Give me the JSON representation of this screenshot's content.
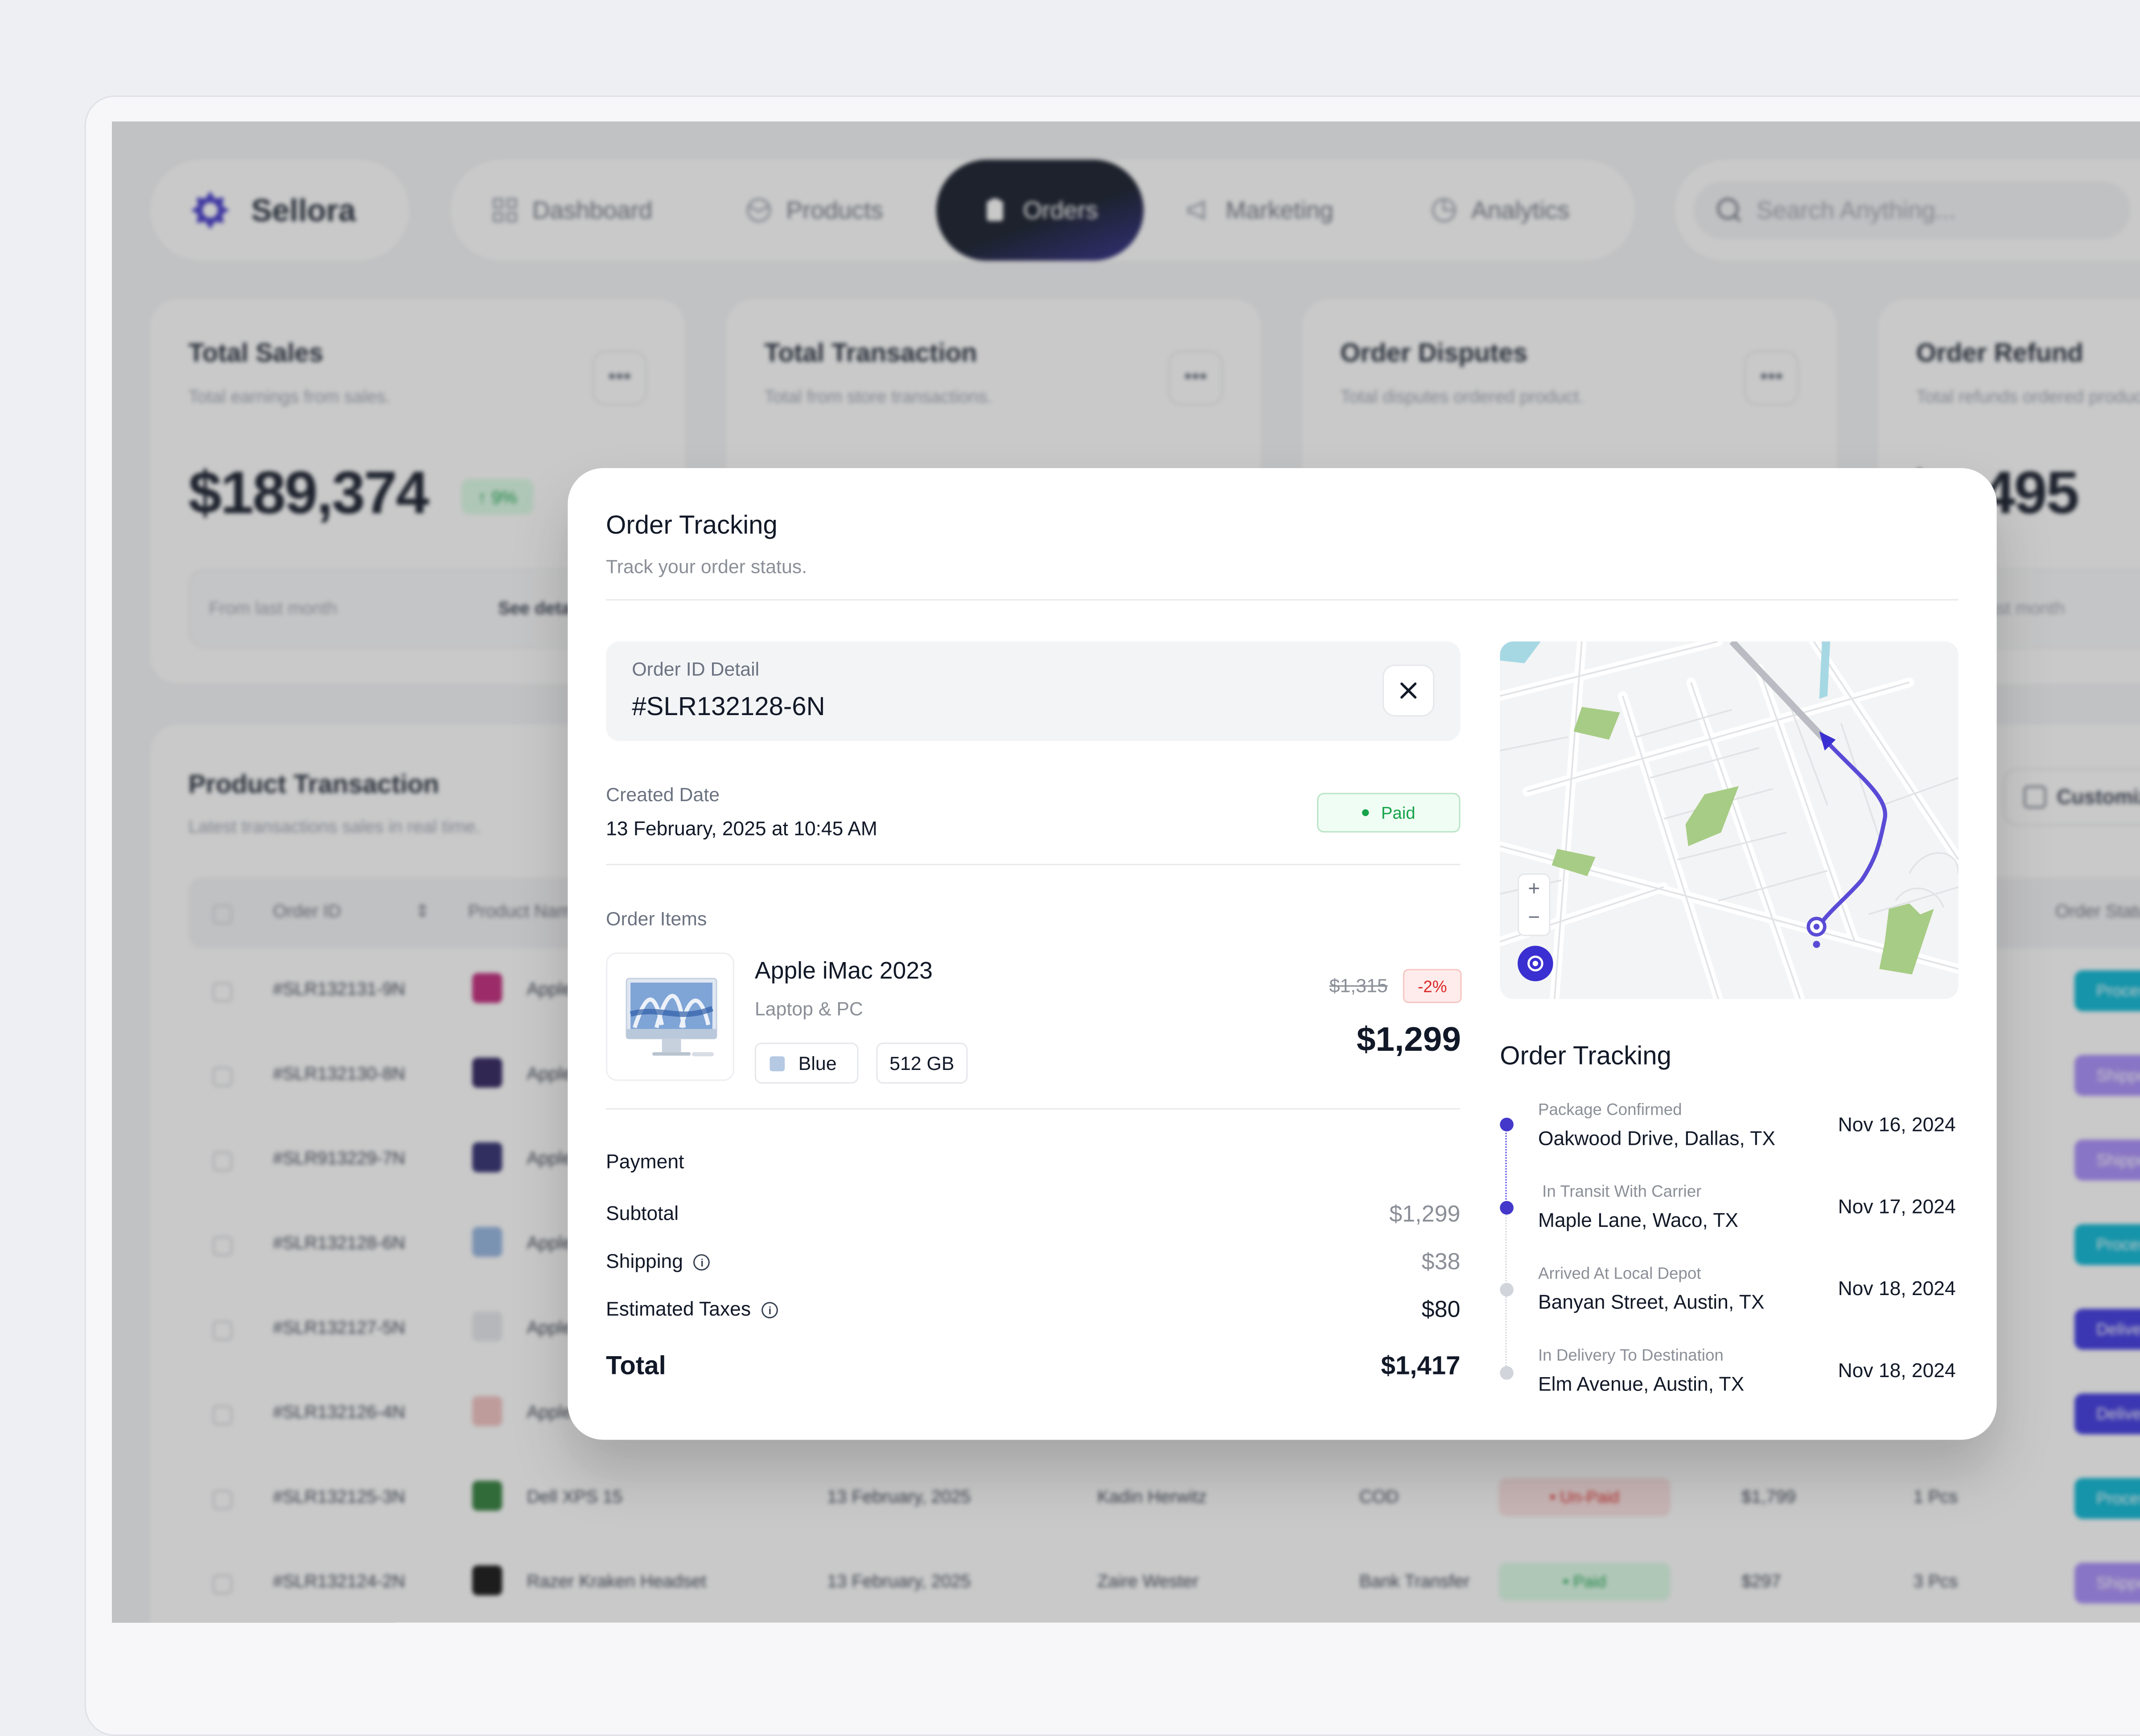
{
  "app": {
    "name": "Sellora"
  },
  "nav": {
    "items": [
      {
        "label": "Dashboard",
        "icon": "dashboard-icon"
      },
      {
        "label": "Products",
        "icon": "box-icon"
      },
      {
        "label": "Orders",
        "icon": "clipboard-icon",
        "active": true
      },
      {
        "label": "Marketing",
        "icon": "megaphone-icon"
      },
      {
        "label": "Analytics",
        "icon": "chart-icon"
      }
    ],
    "search_placeholder": "Search Anything..."
  },
  "stats": [
    {
      "title": "Total Sales",
      "subtitle": "Total earnings from sales.",
      "value": "$189,374",
      "badge": "9%",
      "foot": "From last month",
      "link": "See details"
    },
    {
      "title": "Total Transaction",
      "subtitle": "Total from store transactions.",
      "value": "",
      "badge": "",
      "foot": "",
      "link": ""
    },
    {
      "title": "Order Disputes",
      "subtitle": "Total disputes ordered product.",
      "value": "",
      "badge": "",
      "foot": "",
      "link": ""
    },
    {
      "title": "Order Refund",
      "subtitle": "Total refunds ordered product.",
      "value": "$1,495",
      "badge": "",
      "foot": "From last month",
      "link": ""
    }
  ],
  "transactions": {
    "title": "Product Transaction",
    "subtitle": "Latest transactions sales in real time.",
    "customize_label": "Customize",
    "headers": {
      "order_id": "Order ID",
      "product": "Product Name",
      "status": "Order Status"
    },
    "rows": [
      {
        "id": "#SLR132131-9N",
        "product": "Apple",
        "date": "",
        "customer": "",
        "payment": "",
        "pay_status": "",
        "total": "",
        "qty": "",
        "status": "Processing"
      },
      {
        "id": "#SLR132130-8N",
        "product": "Apple",
        "date": "",
        "customer": "",
        "payment": "",
        "pay_status": "",
        "total": "",
        "qty": "",
        "status": "Shipped"
      },
      {
        "id": "#SLR913229-7N",
        "product": "Apple",
        "date": "",
        "customer": "",
        "payment": "",
        "pay_status": "",
        "total": "",
        "qty": "",
        "status": "Shipped"
      },
      {
        "id": "#SLR132128-6N",
        "product": "Apple",
        "date": "",
        "customer": "",
        "payment": "",
        "pay_status": "",
        "total": "",
        "qty": "",
        "status": "Processing"
      },
      {
        "id": "#SLR132127-5N",
        "product": "Apple",
        "date": "",
        "customer": "",
        "payment": "",
        "pay_status": "",
        "total": "",
        "qty": "",
        "status": "Delivered"
      },
      {
        "id": "#SLR132126-4N",
        "product": "Apple",
        "date": "",
        "customer": "",
        "payment": "",
        "pay_status": "",
        "total": "",
        "qty": "",
        "status": "Delivered"
      },
      {
        "id": "#SLR132125-3N",
        "product": "Dell XPS 15",
        "date": "13 February, 2025",
        "customer": "Kadin Herwitz",
        "payment": "COD",
        "pay_status": "Un-Paid",
        "total": "$1,799",
        "qty": "1 Pcs",
        "status": "Processing"
      },
      {
        "id": "#SLR132124-2N",
        "product": "Razer Kraken Headset",
        "date": "13 February, 2025",
        "customer": "Zaire Wester",
        "payment": "Bank Transfer",
        "pay_status": "Paid",
        "total": "$297",
        "qty": "3 Pcs",
        "status": "Shipped"
      }
    ]
  },
  "modal": {
    "title": "Order Tracking",
    "subtitle": "Track your order status.",
    "order_id_label": "Order ID Detail",
    "order_id": "#SLR132128-6N",
    "created_label": "Created Date",
    "created_value": "13 February, 2025 at 10:45 AM",
    "payment_status": "Paid",
    "items_label": "Order Items",
    "item": {
      "name": "Apple iMac 2023",
      "category": "Laptop & PC",
      "color": "Blue",
      "storage": "512 GB",
      "old_price": "$1,315",
      "discount": "-2%",
      "price": "$1,299"
    },
    "payment": {
      "label": "Payment",
      "subtotal_label": "Subtotal",
      "subtotal": "$1,299",
      "shipping_label": "Shipping",
      "shipping": "$38",
      "taxes_label": "Estimated Taxes",
      "taxes": "$80",
      "total_label": "Total",
      "total": "$1,417"
    },
    "tracking": {
      "title": "Order Tracking",
      "steps": [
        {
          "label": "Package Confirmed",
          "place": "Oakwood Drive, Dallas, TX",
          "date": "Nov 16, 2024",
          "done": true
        },
        {
          "label": "In Transit With Carrier",
          "place": "Maple Lane, Waco, TX",
          "date": "Nov 17, 2024",
          "done": true
        },
        {
          "label": "Arrived At Local Depot",
          "place": "Banyan Street, Austin, TX",
          "date": "Nov 18, 2024",
          "done": false
        },
        {
          "label": "In Delivery To Destination",
          "place": "Elm Avenue, Austin, TX",
          "date": "Nov 18, 2024",
          "done": false
        }
      ]
    }
  },
  "colors": {
    "accent": "#4338ca",
    "route": "#5a4bd6",
    "paid": "#16a34a",
    "discount": "#dc2626"
  }
}
